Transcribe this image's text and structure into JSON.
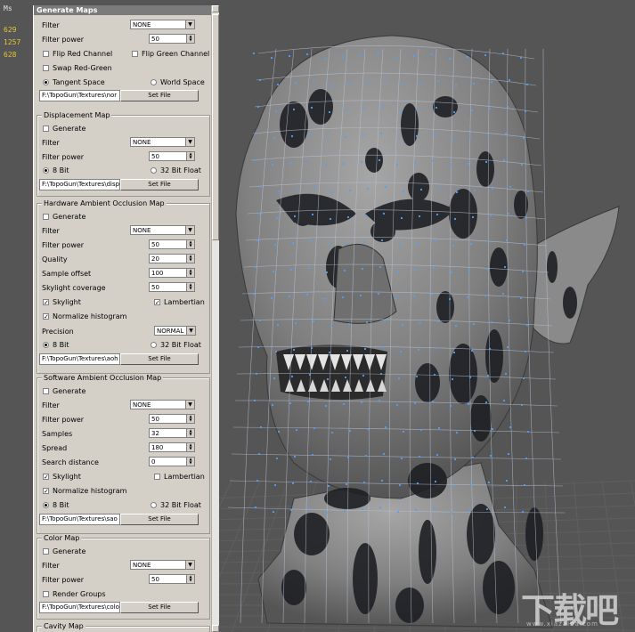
{
  "stats": {
    "header": "Ms",
    "values": [
      "629",
      "1257",
      "628"
    ]
  },
  "panel": {
    "title": "Generate Maps",
    "normal_map": {
      "filter_label": "Filter",
      "filter_value": "NONE",
      "power_label": "Filter power",
      "power_value": "50",
      "flip_red": "Flip Red Channel",
      "flip_green": "Flip Green Channel",
      "swap": "Swap Red-Green",
      "tangent": "Tangent Space",
      "world": "World Space",
      "path": "F:\\TopoGun\\Textures\\nor",
      "set_file": "Set File"
    },
    "displacement": {
      "title": "Displacement Map",
      "generate": "Generate",
      "filter_label": "Filter",
      "filter_value": "NONE",
      "power_label": "Filter power",
      "power_value": "50",
      "bit8": "8 Bit",
      "bit32": "32 Bit Float",
      "path": "F:\\TopoGun\\Textures\\disp",
      "set_file": "Set File"
    },
    "hw_ao": {
      "title": "Hardware Ambient Occlusion Map",
      "generate": "Generate",
      "filter_label": "Filter",
      "filter_value": "NONE",
      "power_label": "Filter power",
      "power_value": "50",
      "quality_label": "Quality",
      "quality_value": "20",
      "offset_label": "Sample offset",
      "offset_value": "100",
      "sky_cov_label": "Skylight coverage",
      "sky_cov_value": "50",
      "skylight": "Skylight",
      "lambertian": "Lambertian",
      "normalize": "Normalize histogram",
      "precision_label": "Precision",
      "precision_value": "NORMAL",
      "bit8": "8 Bit",
      "bit32": "32 Bit Float",
      "path": "F:\\TopoGun\\Textures\\aoh",
      "set_file": "Set File"
    },
    "sw_ao": {
      "title": "Software Ambient Occlusion Map",
      "generate": "Generate",
      "filter_label": "Filter",
      "filter_value": "NONE",
      "power_label": "Filter power",
      "power_value": "50",
      "samples_label": "Samples",
      "samples_value": "32",
      "spread_label": "Spread",
      "spread_value": "180",
      "search_label": "Search distance",
      "search_value": "0",
      "skylight": "Skylight",
      "lambertian": "Lambertian",
      "normalize": "Normalize histogram",
      "bit8": "8 Bit",
      "bit32": "32 Bit Float",
      "path": "F:\\TopoGun\\Textures\\sao",
      "set_file": "Set File"
    },
    "color_map": {
      "title": "Color Map",
      "generate": "Generate",
      "filter_label": "Filter",
      "filter_value": "NONE",
      "power_label": "Filter power",
      "power_value": "50",
      "render_groups": "Render Groups",
      "path": "F:\\TopoGun\\Textures\\colo",
      "set_file": "Set File"
    },
    "next_group_title": "Cavity Map"
  },
  "watermark": {
    "main": "下载吧",
    "sub": "www.xiazaiba.com"
  }
}
